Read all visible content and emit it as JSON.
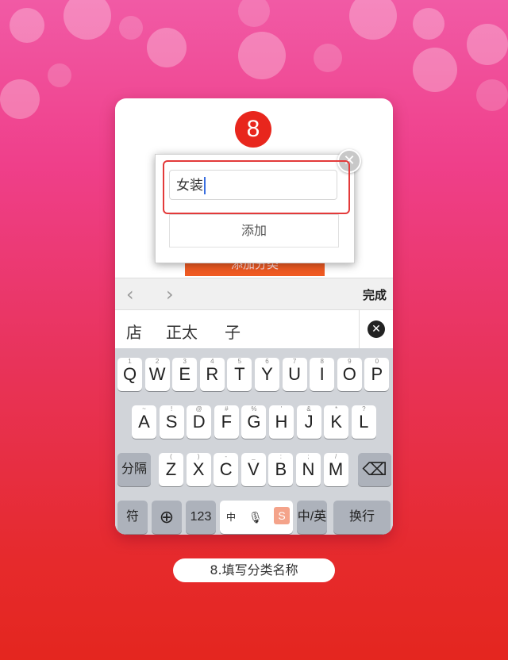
{
  "step_number": "8",
  "dialog": {
    "input_value": "女装",
    "add_button_label": "添加",
    "close_icon": "close-icon",
    "background_button_label": "添加分类"
  },
  "toolbar": {
    "prev_icon": "chevron-left-icon",
    "next_icon": "chevron-right-icon",
    "done_label": "完成"
  },
  "candidates": [
    "店",
    "正太",
    "子"
  ],
  "keyboard": {
    "row1": [
      "Q",
      "W",
      "E",
      "R",
      "T",
      "Y",
      "U",
      "I",
      "O",
      "P"
    ],
    "row1_hints": [
      "1",
      "2",
      "3",
      "4",
      "5",
      "6",
      "7",
      "8",
      "9",
      "0"
    ],
    "row2": [
      "A",
      "S",
      "D",
      "F",
      "G",
      "H",
      "J",
      "K",
      "L"
    ],
    "row2_hints": [
      "~",
      "!",
      "@",
      "#",
      "%",
      "'",
      "&",
      "*",
      "?"
    ],
    "row3": [
      "Z",
      "X",
      "C",
      "V",
      "B",
      "N",
      "M"
    ],
    "row3_hints": [
      "(",
      ")",
      "-",
      "_",
      ":",
      ";",
      "/"
    ],
    "separator_label": "分隔",
    "symbols_label": "符",
    "numbers_label": "123",
    "space_label": "中",
    "lang_switch": "中/英",
    "return_label": "换行"
  },
  "caption": "8.填写分类名称",
  "colors": {
    "accent": "#e8261d",
    "button_orange": "#ef5a22"
  }
}
